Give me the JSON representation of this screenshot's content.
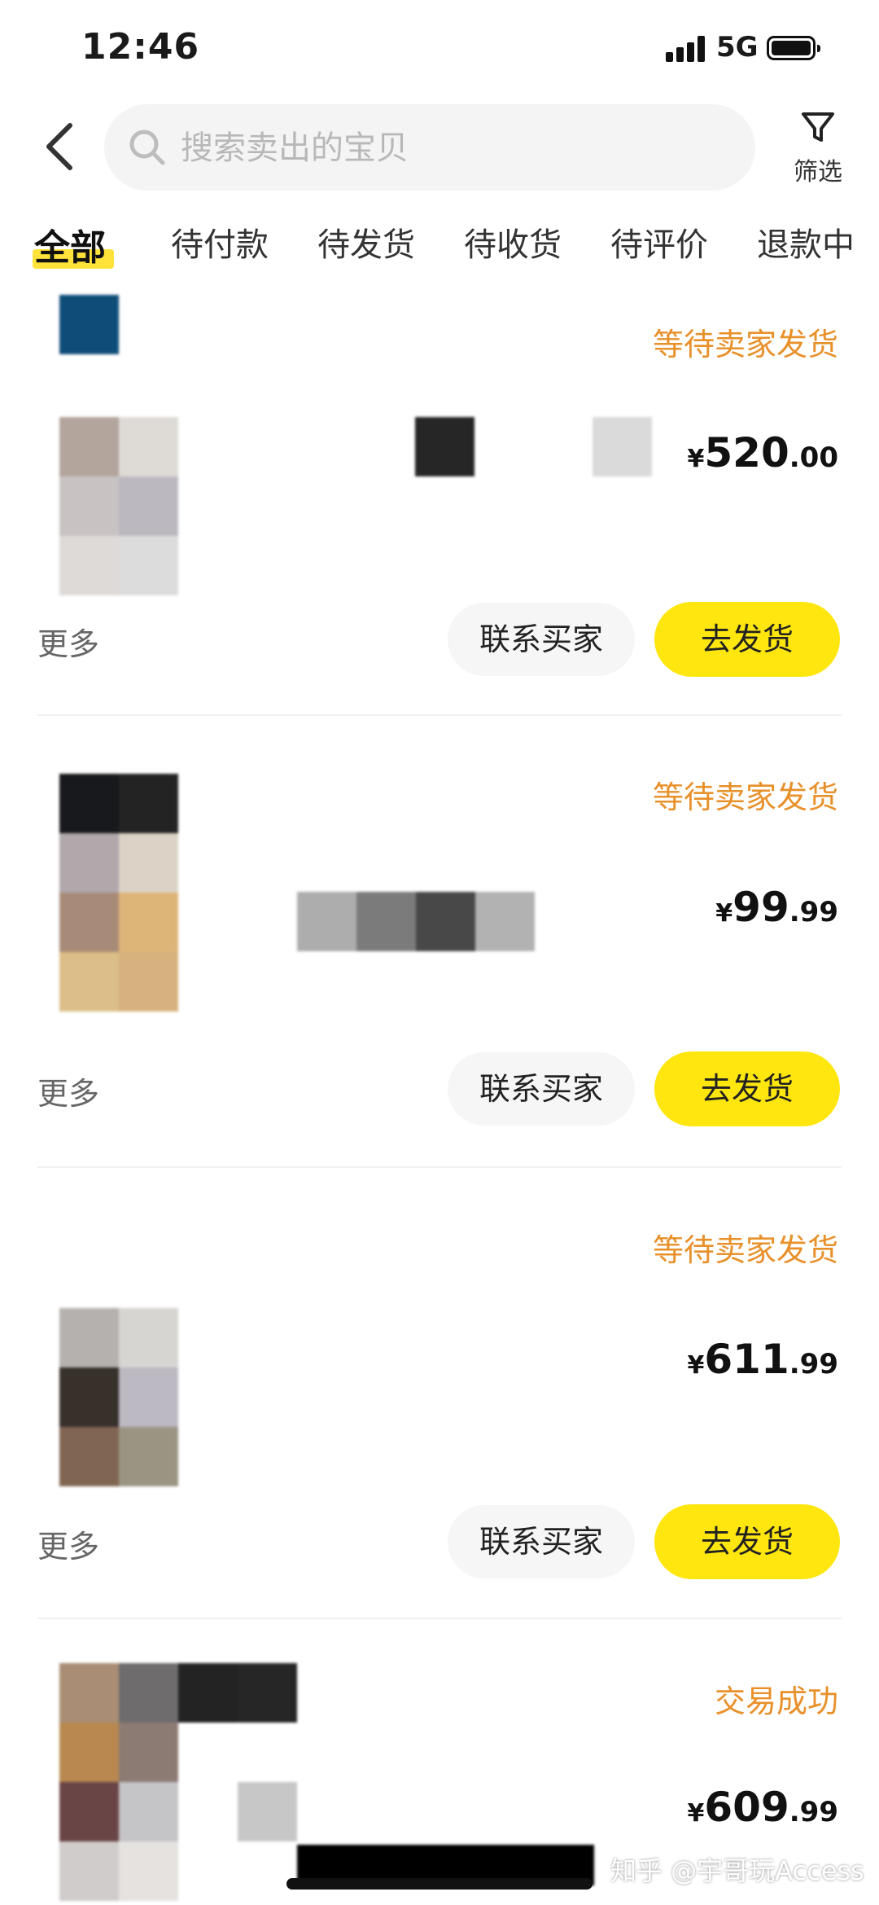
{
  "status_bar": {
    "time": "12:46",
    "network": "5G"
  },
  "header": {
    "search_placeholder": "搜索卖出的宝贝",
    "filter_label": "筛选"
  },
  "tabs": [
    {
      "label": "全部",
      "active": true
    },
    {
      "label": "待付款",
      "active": false
    },
    {
      "label": "待发货",
      "active": false
    },
    {
      "label": "待收货",
      "active": false
    },
    {
      "label": "待评价",
      "active": false
    },
    {
      "label": "退款中",
      "active": false
    }
  ],
  "orders": [
    {
      "status": "等待卖家发货",
      "price_currency": "¥",
      "price_int": "520",
      "price_dec": ".00",
      "more": "更多",
      "contact": "联系买家",
      "action": "去发货"
    },
    {
      "status": "等待卖家发货",
      "price_currency": "¥",
      "price_int": "99",
      "price_dec": ".99",
      "more": "更多",
      "contact": "联系买家",
      "action": "去发货"
    },
    {
      "status": "等待卖家发货",
      "price_currency": "¥",
      "price_int": "611",
      "price_dec": ".99",
      "more": "更多",
      "contact": "联系买家",
      "action": "去发货"
    },
    {
      "status": "交易成功",
      "price_currency": "¥",
      "price_int": "609",
      "price_dec": ".99"
    }
  ],
  "watermark": "知乎 @宇哥玩Access",
  "colors": {
    "accent_yellow": "#ffe60f",
    "status_orange": "#e8902a",
    "tab_underline": "#ffe33a"
  }
}
